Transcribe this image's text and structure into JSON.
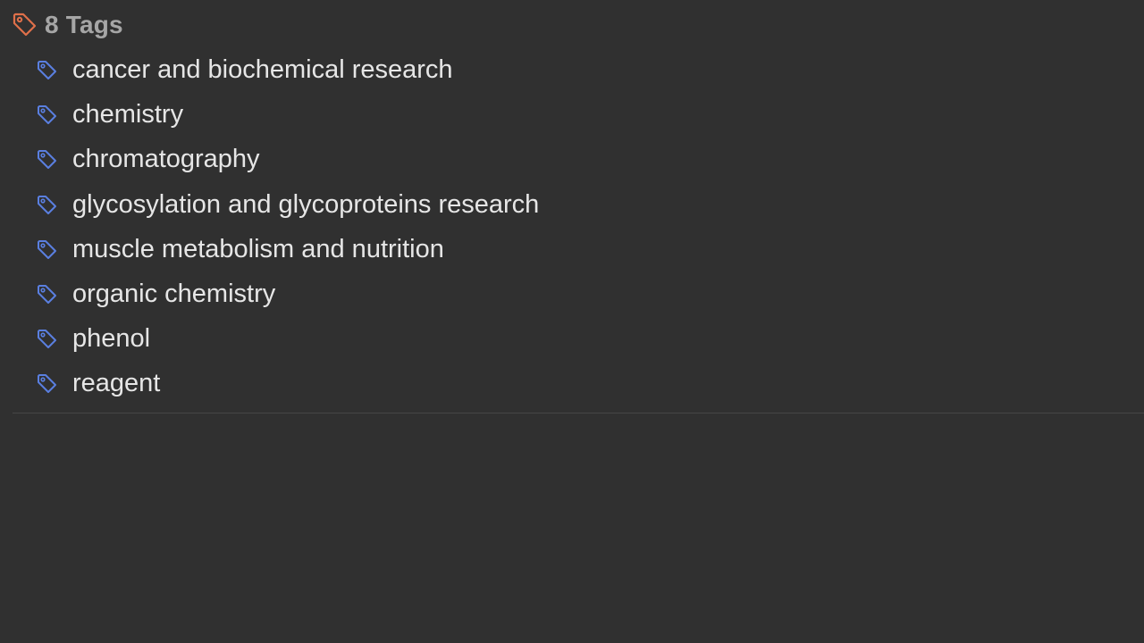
{
  "header": {
    "icon": "tag-icon",
    "title": "8 Tags",
    "icon_color": "#e0704a"
  },
  "tags": {
    "icon_color": "#5a7fe0",
    "items": [
      {
        "label": "cancer and biochemical research"
      },
      {
        "label": "chemistry"
      },
      {
        "label": "chromatography"
      },
      {
        "label": "glycosylation and glycoproteins research"
      },
      {
        "label": "muscle metabolism and nutrition"
      },
      {
        "label": "organic chemistry"
      },
      {
        "label": "phenol"
      },
      {
        "label": "reagent"
      }
    ]
  }
}
